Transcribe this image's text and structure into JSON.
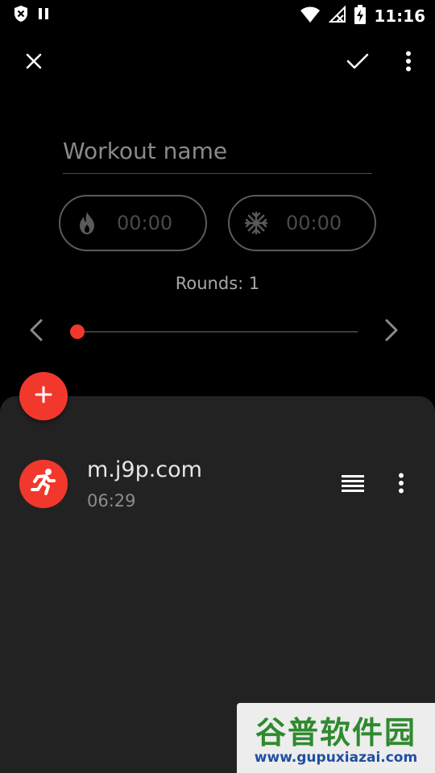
{
  "status_bar": {
    "time": "11:16"
  },
  "toolbar": {
    "close_icon": "close-icon",
    "confirm_icon": "check-icon",
    "more_icon": "more-vert-icon"
  },
  "workout": {
    "name_placeholder": "Workout name",
    "name_value": "",
    "warmup_time": "00:00",
    "cooldown_time": "00:00",
    "rounds_label": "Rounds: 1"
  },
  "exercises": [
    {
      "name": "m.j9p.com",
      "duration": "06:29",
      "icon": "running-icon"
    }
  ],
  "watermark": {
    "title": "谷普软件园",
    "url": "www.gupuxiazai.com"
  },
  "colors": {
    "accent": "#f2382c",
    "background": "#000000",
    "sheet": "#222222"
  }
}
